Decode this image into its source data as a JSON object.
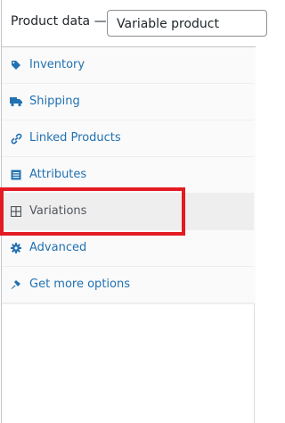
{
  "header": {
    "label": "Product data —",
    "product_type": "Variable product"
  },
  "tabs": [
    {
      "label": "Inventory",
      "icon": "tag-icon"
    },
    {
      "label": "Shipping",
      "icon": "truck-icon"
    },
    {
      "label": "Linked Products",
      "icon": "link-icon"
    },
    {
      "label": "Attributes",
      "icon": "list-icon"
    },
    {
      "label": "Variations",
      "icon": "grid-icon",
      "active": true
    },
    {
      "label": "Advanced",
      "icon": "gear-icon"
    },
    {
      "label": "Get more options",
      "icon": "plugin-icon"
    }
  ],
  "colors": {
    "link": "#2271b1",
    "active_text": "#50575e",
    "highlight": "#e31b23"
  }
}
